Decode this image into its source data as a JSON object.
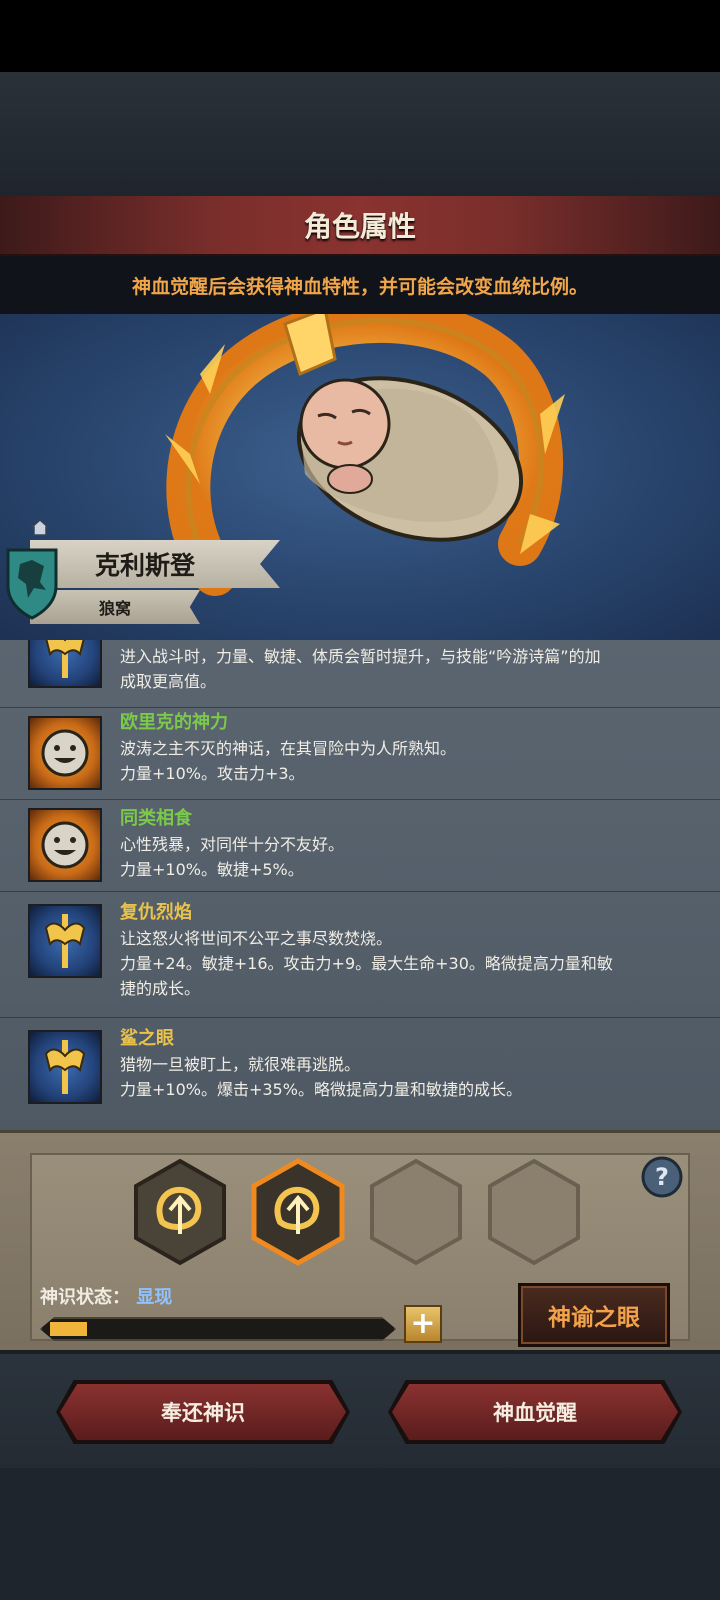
{
  "header": {
    "title": "角色属性",
    "notice": "神血觉醒后会获得神血特性，并可能会改变血统比例。"
  },
  "character": {
    "name": "克利斯登",
    "origin": "狼窝",
    "shield_color": "#2f8a86"
  },
  "traits": [
    {
      "icon": "axe-icon",
      "name": "",
      "desc": "进入战斗时，力量、敏捷、体质会暂时提升，与技能“吟游诗篇”的加",
      "effect": "成取更高值。",
      "name_class": "gold",
      "icon_class": "blue"
    },
    {
      "icon": "smiley-face-icon",
      "name": "欧里克的神力",
      "desc": "波涛之主不灭的神话，在其冒险中为人所熟知。",
      "effect": "力量+10%。攻击力+3。",
      "name_class": "green",
      "icon_class": "orange"
    },
    {
      "icon": "smiley-face-icon",
      "name": "同类相食",
      "desc": "心性残暴，对同伴十分不友好。",
      "effect": "力量+10%。敏捷+5%。",
      "name_class": "green",
      "icon_class": "orange"
    },
    {
      "icon": "axe-icon",
      "name": "复仇烈焰",
      "desc": "让这怒火将世间不公平之事尽数焚烧。",
      "effect": "力量+24。敏捷+16。攻击力+9。最大生命+30。略微提高力量和敏",
      "effect2": "捷的成长。",
      "name_class": "gold",
      "icon_class": "blue"
    },
    {
      "icon": "axe-icon",
      "name": "鲨之眼",
      "desc": "猎物一旦被盯上，就很难再逃脱。",
      "effect": "力量+10%。爆击+35%。略微提高力量和敏捷的成长。",
      "name_class": "gold",
      "icon_class": "blue"
    }
  ],
  "slots": {
    "status_label": "神识状态：",
    "status_value": "显现",
    "progress": 0.11,
    "plus_label": "+",
    "oracle_label": "神谕之眼",
    "filled": 2,
    "total": 4
  },
  "actions": {
    "return_label": "奉还神识",
    "awaken_label": "神血觉醒"
  },
  "colors": {
    "accent_orange": "#f1a64a",
    "trait_green": "#7bc94a",
    "trait_gold": "#e9c24c",
    "status_blue": "#8fc3ff"
  }
}
